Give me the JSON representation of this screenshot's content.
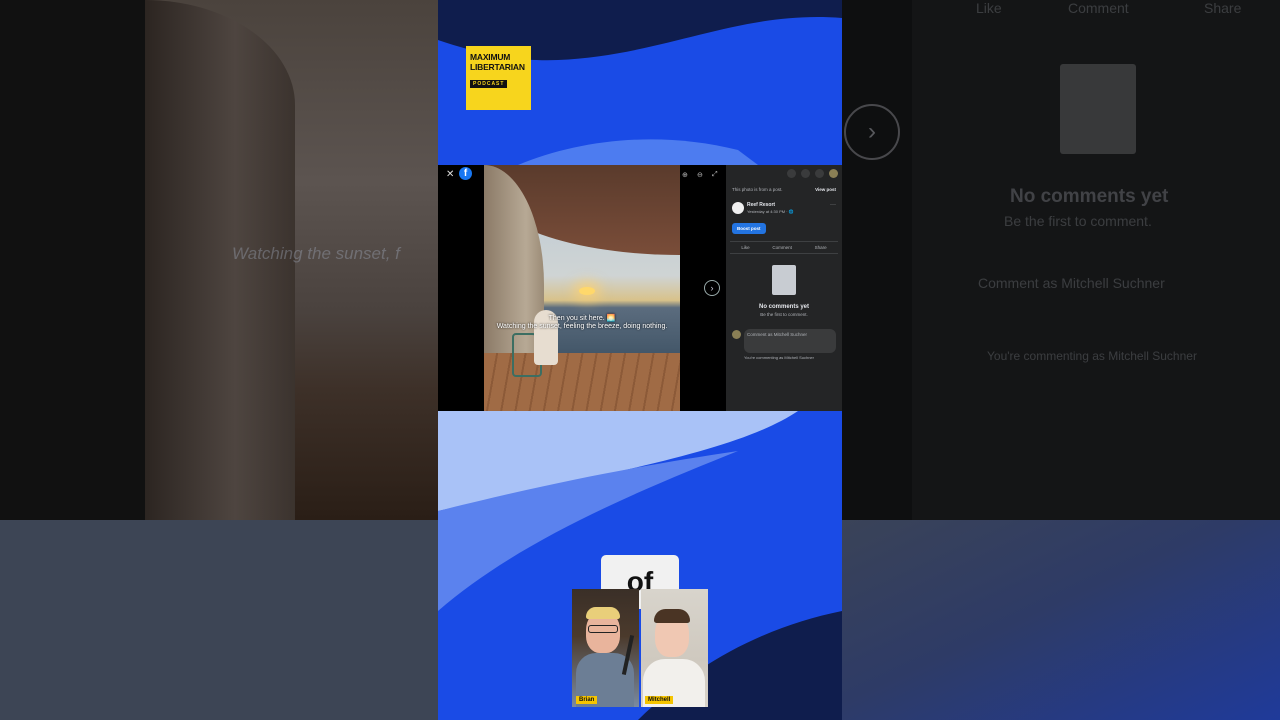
{
  "colors": {
    "brand_blue": "#1a4be6",
    "logo_yellow": "#f7d51d",
    "fb_blue": "#1877f2"
  },
  "background_left": {
    "ghost_caption": "Watching the sunset, f"
  },
  "background_right": {
    "like_label": "Like",
    "comment_label": "Comment",
    "share_label": "Share",
    "no_comments_title": "No comments yet",
    "no_comments_sub": "Be the first to comment.",
    "comment_placeholder": "Comment as Mitchell Suchner",
    "commenting_as": "You're commenting as Mitchell Suchner"
  },
  "logo": {
    "line1": "MAXIMUM",
    "line2": "LIBERTARIAN",
    "line3": "PODCAST"
  },
  "post_viewer": {
    "close_icon": "close-icon",
    "photo_caption_1": "Then you sit here. 🌅",
    "photo_caption_2": "Watching the sunset, feeling the breeze, doing nothing.",
    "next_icon": "chevron-right-icon"
  },
  "fb_panel": {
    "notice": "This photo is from a post.",
    "view_post": "View post",
    "page_name": "Reef Resort",
    "post_time": "Yesterday at 4:30 PM · 🌐",
    "more": "···",
    "boost_label": "Boost post",
    "like": "Like",
    "comment": "Comment",
    "share": "Share",
    "no_comments_title": "No comments yet",
    "no_comments_sub": "Be the first to comment.",
    "comment_placeholder": "Comment as Mitchell Suchner",
    "commenting_as": "You're commenting as Mitchell Suchner"
  },
  "caption_word": "of",
  "webcams": [
    {
      "name": "Brian"
    },
    {
      "name": "Mitchell"
    }
  ]
}
